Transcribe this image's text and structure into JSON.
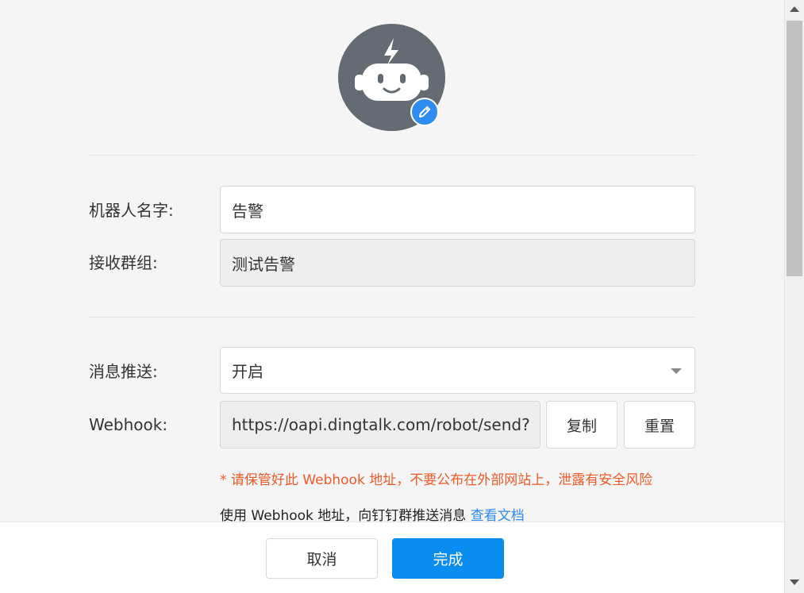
{
  "robot": {
    "avatar_icon": "robot-icon",
    "edit_icon": "pencil-icon",
    "avatar_bg_color": "#646b73",
    "edit_badge_color": "#2e8cf0"
  },
  "form": {
    "name": {
      "label": "机器人名字:",
      "value": "告警"
    },
    "group": {
      "label": "接收群组:",
      "value": "测试告警"
    },
    "push": {
      "label": "消息推送:",
      "value": "开启",
      "icon": "chevron-down-icon"
    },
    "webhook": {
      "label": "Webhook:",
      "value": "https://oapi.dingtalk.com/robot/send?",
      "copy_label": "复制",
      "reset_label": "重置"
    },
    "warning": "* 请保管好此 Webhook 地址，不要公布在外部网站上，泄露有安全风险",
    "hint": {
      "text": "使用 Webhook 地址，向钉钉群推送消息 ",
      "link": "查看文档"
    }
  },
  "footer": {
    "cancel_label": "取消",
    "done_label": "完成"
  },
  "colors": {
    "primary": "#0a8cf0",
    "warning": "#f05a28",
    "link": "#2e8cf0"
  }
}
